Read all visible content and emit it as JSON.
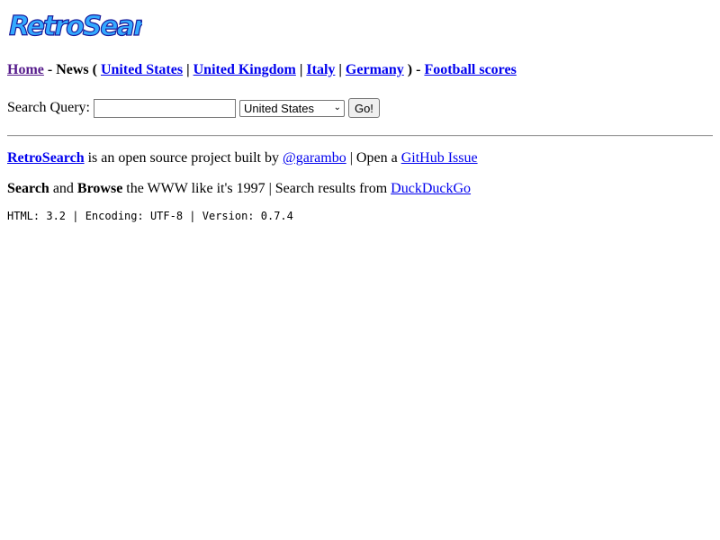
{
  "logo": {
    "text": "RetroSearch",
    "fill_color": "#33aaff",
    "outline_color": "#1a1a99"
  },
  "nav": {
    "home": "Home",
    "news": "- News (",
    "countries": [
      "United States",
      "United Kingdom",
      "Italy",
      "Germany"
    ],
    "separator": "|",
    "close": ") -",
    "football": "Football scores"
  },
  "search": {
    "label": "Search Query:",
    "value": "",
    "placeholder": "",
    "selected_country": "United States",
    "go_label": "Go!"
  },
  "about": {
    "brand": "RetroSearch",
    "text1": "is an open source project built by",
    "author": "@garambo",
    "text2": "| Open a",
    "github": "GitHub Issue"
  },
  "tagline": {
    "search": "Search",
    "and": "and",
    "browse": "Browse",
    "text": "the WWW like it's 1997 | Search results from",
    "provider": "DuckDuckGo"
  },
  "meta": {
    "text": "HTML: 3.2 | Encoding: UTF-8 | Version: 0.7.4"
  },
  "colors": {
    "link": "#0000ee",
    "visited": "#551a8b"
  }
}
